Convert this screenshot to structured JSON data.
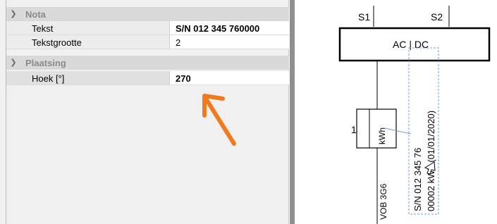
{
  "property_grid": {
    "categories": [
      {
        "label": "Nota",
        "properties": [
          {
            "name": "Tekst",
            "value": "S/N 012 345 760000"
          },
          {
            "name": "Tekstgrootte",
            "value": "2"
          }
        ]
      },
      {
        "label": "Plaatsing",
        "properties": [
          {
            "name": "Hoek [°]",
            "value": "270"
          }
        ]
      }
    ],
    "expand_icon": "chevron-down-icon",
    "annotation_arrow_color": "#f07b1e"
  },
  "drawing": {
    "terminal_left": "S1",
    "terminal_right": "S2",
    "box_label": "AC | DC",
    "meter_index": "1",
    "meter_label": "kWh",
    "cable_label": "VOB 3G6",
    "note_line1": "S/N 012 345 76",
    "note_line2": "00002 kWh (01/01/2020)",
    "selection_color": "#6f9ee0"
  }
}
